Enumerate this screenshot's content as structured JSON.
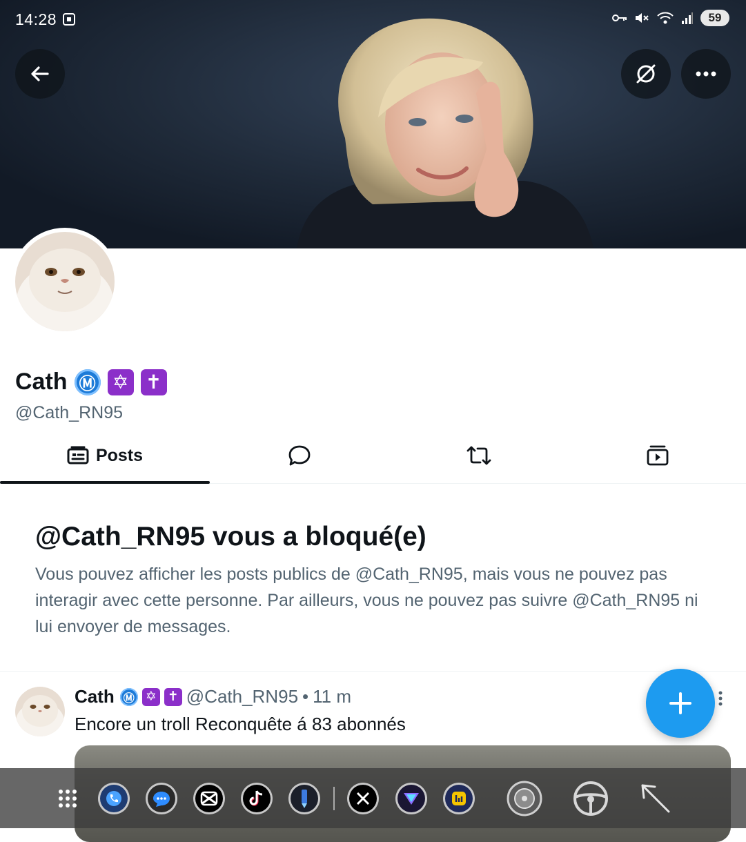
{
  "status_bar": {
    "time": "14:28",
    "battery": "59"
  },
  "profile": {
    "name": "Cath",
    "badges": [
      "Ⓜ",
      "✡",
      "✝"
    ],
    "handle": "@Cath_RN95"
  },
  "tabs": [
    {
      "label": "Posts",
      "icon": "feed-icon",
      "active": true
    },
    {
      "label": "",
      "icon": "reply-bubble-icon",
      "active": false
    },
    {
      "label": "",
      "icon": "repost-icon",
      "active": false
    },
    {
      "label": "",
      "icon": "media-icon",
      "active": false
    }
  ],
  "blocked": {
    "title": "@Cath_RN95 vous a bloqué(e)",
    "text": "Vous pouvez afficher les posts publics de @Cath_RN95, mais vous ne pouvez pas interagir avec cette personne. Par ailleurs, vous ne pouvez pas suivre @Cath_RN95 ni lui envoyer de messages."
  },
  "post": {
    "name": "Cath",
    "handle": "@Cath_RN95",
    "dot": "•",
    "time": "11 m",
    "text": "Encore un troll Reconquête á 83 abonnés"
  },
  "colors": {
    "accent": "#1d9bf0",
    "secondary_text": "#536471",
    "badge_purple": "#8b2fc9"
  },
  "dock": [
    "apps-grid-icon",
    "phone-icon",
    "messages-icon",
    "capcut-icon",
    "tiktok-icon",
    "pen-app-icon",
    "x-icon",
    "proton-vpn-icon",
    "app-icon",
    "wheel-icon",
    "steering-wheel-icon",
    "cursor-arrow-icon"
  ]
}
